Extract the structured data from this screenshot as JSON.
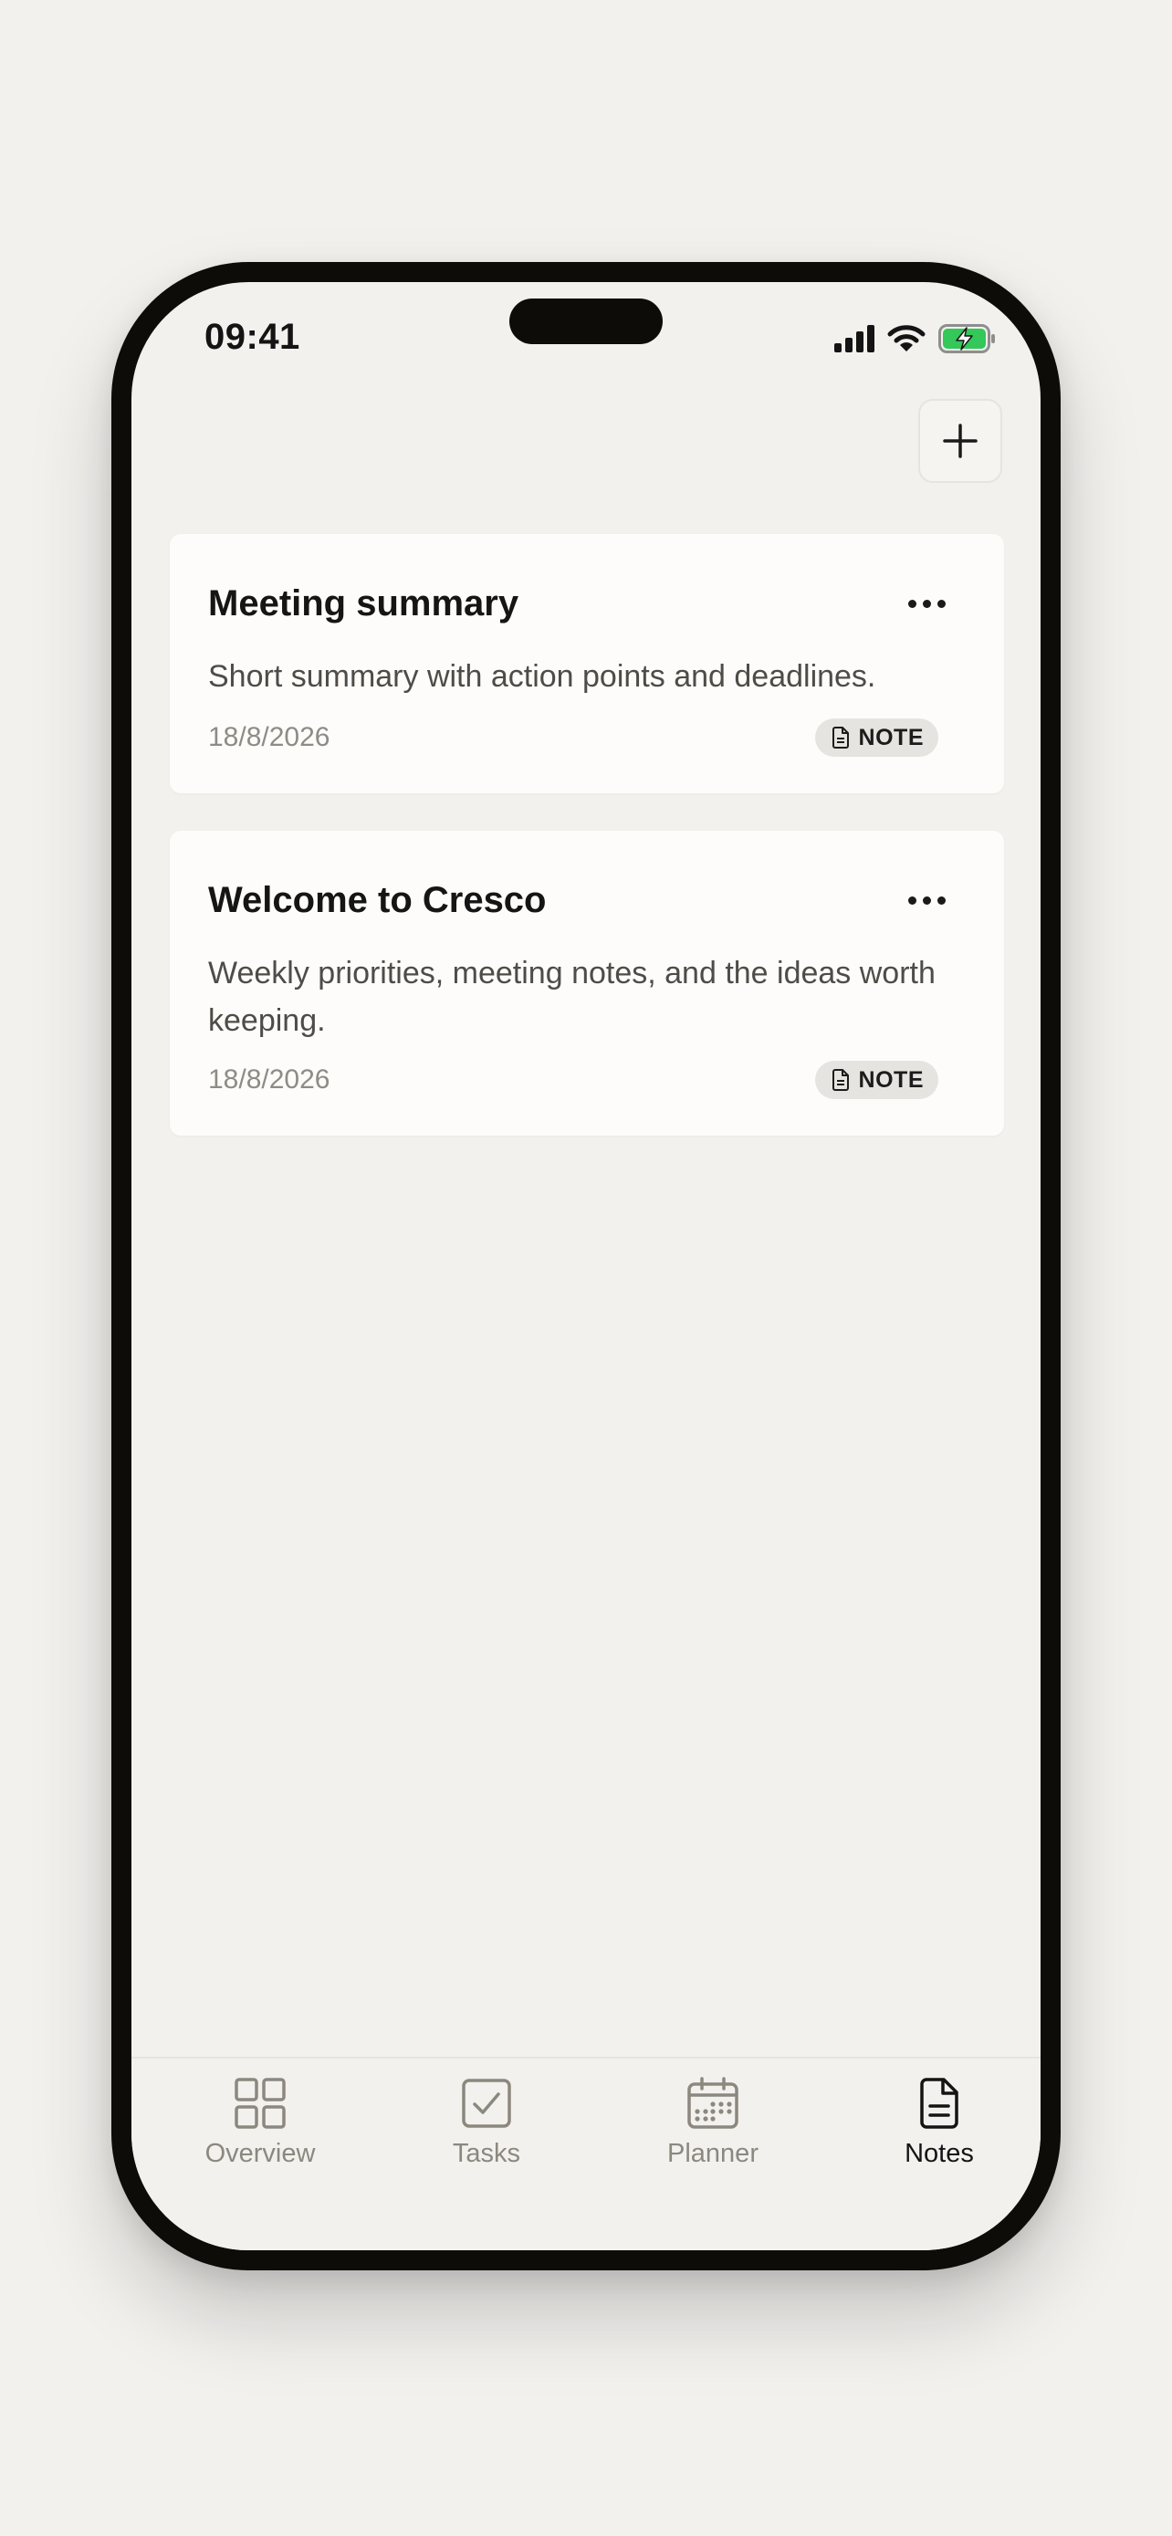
{
  "status_bar": {
    "time": "09:41"
  },
  "header": {
    "add_icon": "plus-icon"
  },
  "notes": [
    {
      "title": "Meeting summary",
      "description": "Short summary with action points and deadlines.",
      "date": "18/8/2026",
      "badge": "NOTE"
    },
    {
      "title": "Welcome to Cresco",
      "description": "Weekly priorities, meeting notes, and the ideas worth keeping.",
      "date": "18/8/2026",
      "badge": "NOTE"
    }
  ],
  "tabbar": {
    "tabs": [
      {
        "label": "Overview",
        "icon": "grid-icon",
        "active": false
      },
      {
        "label": "Tasks",
        "icon": "checkbox-icon",
        "active": false
      },
      {
        "label": "Planner",
        "icon": "calendar-icon",
        "active": false
      },
      {
        "label": "Notes",
        "icon": "document-icon",
        "active": true
      }
    ]
  },
  "colors": {
    "background": "#f2f1ee",
    "card": "#fdfcfa",
    "battery": "#34c759",
    "inactive_tab": "#8c887f",
    "active_tab": "#141414"
  }
}
